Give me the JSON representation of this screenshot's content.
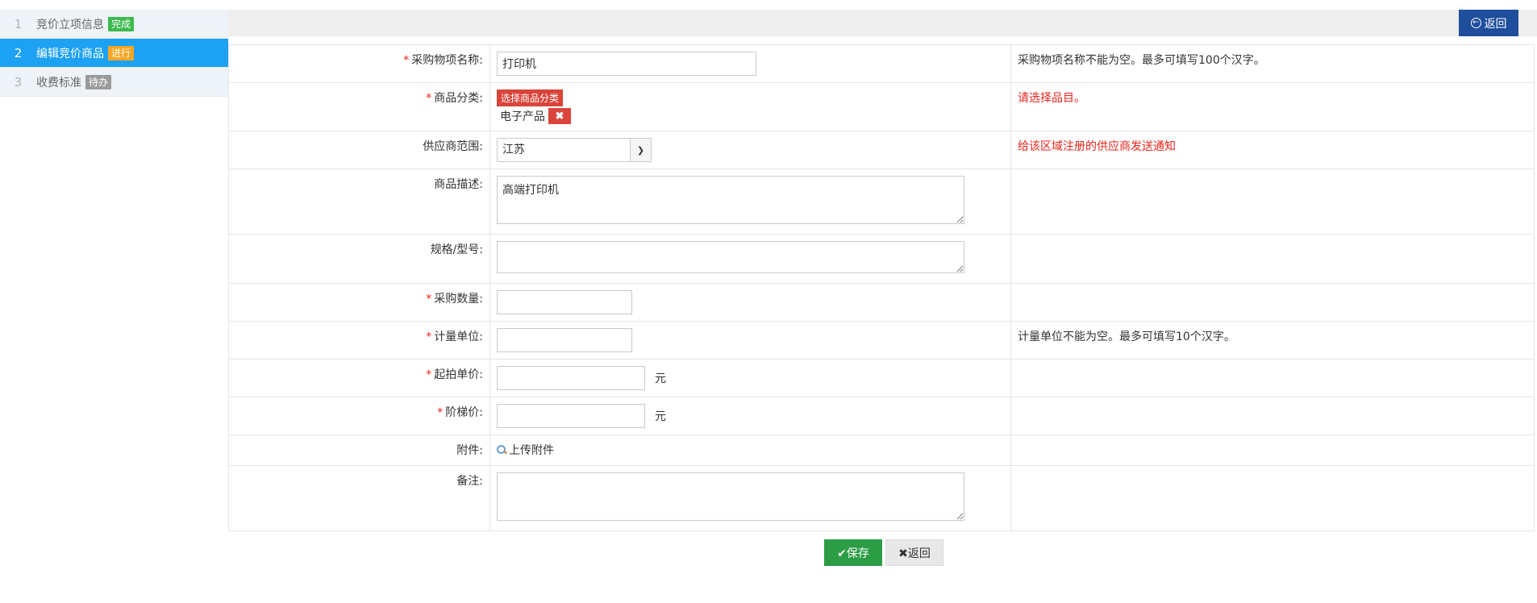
{
  "sidebar": {
    "steps": [
      {
        "num": "1",
        "label": "竞价立项信息",
        "badge": "完成"
      },
      {
        "num": "2",
        "label": "编辑竞价商品",
        "badge": "进行"
      },
      {
        "num": "3",
        "label": "收费标准",
        "badge": "待办"
      }
    ]
  },
  "header": {
    "back_label": "返回"
  },
  "form": {
    "name": {
      "label": "采购物项名称:",
      "value": "打印机",
      "hint": "采购物项名称不能为空。最多可填写100个汉字。"
    },
    "category": {
      "label": "商品分类:",
      "button": "选择商品分类",
      "chip": "电子产品",
      "hint": "请选择品目。"
    },
    "supplier": {
      "label": "供应商范围:",
      "value": "江苏",
      "hint": "给该区域注册的供应商发送通知"
    },
    "desc": {
      "label": "商品描述:",
      "value": "高端打印机"
    },
    "spec": {
      "label": "规格/型号:",
      "value": ""
    },
    "qty": {
      "label": "采购数量:",
      "value": ""
    },
    "unit": {
      "label": "计量单位:",
      "value": "",
      "hint": "计量单位不能为空。最多可填写10个汉字。"
    },
    "start_price": {
      "label": "起拍单价:",
      "value": "",
      "unit": "元"
    },
    "step_price": {
      "label": "阶梯价:",
      "value": "",
      "unit": "元"
    },
    "attachment": {
      "label": "附件:",
      "link": "上传附件"
    },
    "remark": {
      "label": "备注:",
      "value": ""
    }
  },
  "required_mark": "*",
  "actions": {
    "save": "保存",
    "back": "返回"
  },
  "colors": {
    "accent": "#1da1f2",
    "primary_dark": "#1e4e9c",
    "danger": "#d9453a",
    "success": "#2d9d45"
  }
}
